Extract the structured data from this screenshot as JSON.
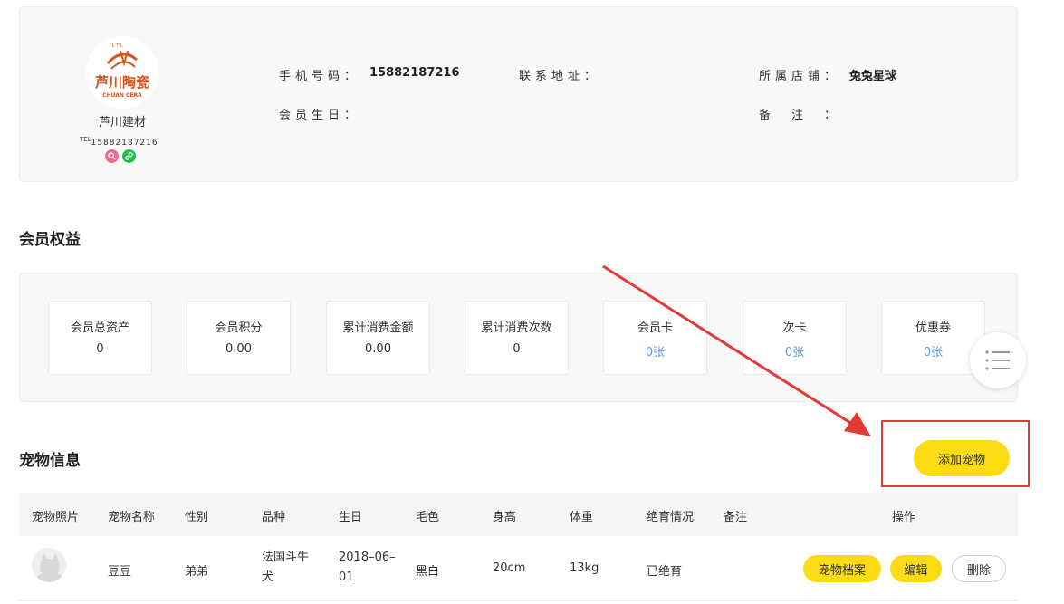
{
  "profile": {
    "store_name": "芦川建材",
    "logo_text_top": "芦川陶瓷",
    "logo_text_bottom": "CHUAN CERA",
    "logo_mark": "L T L",
    "tel_prefix": "TEL",
    "tel_number": "15882187216",
    "phone_label": "手机号码：",
    "phone_value": "15882187216",
    "address_label": "联系地址：",
    "address_value": "",
    "store_label": "所属店铺：",
    "store_value": "兔兔星球",
    "birthday_label": "会员生日：",
    "birthday_value": "",
    "remark_label": "备　注　：",
    "remark_value": ""
  },
  "benefits": {
    "title": "会员权益",
    "items": [
      {
        "label": "会员总资产",
        "value": "0"
      },
      {
        "label": "会员积分",
        "value": "0.00"
      },
      {
        "label": "累计消费金额",
        "value": "0.00"
      },
      {
        "label": "累计消费次数",
        "value": "0"
      },
      {
        "label": "会员卡",
        "value": "0张"
      },
      {
        "label": "次卡",
        "value": "0张"
      },
      {
        "label": "优惠券",
        "value": "0张"
      }
    ]
  },
  "pets": {
    "title": "宠物信息",
    "add_label": "添加宠物",
    "columns": [
      "宠物照片",
      "宠物名称",
      "性别",
      "品种",
      "生日",
      "毛色",
      "身高",
      "体重",
      "绝育情况",
      "备注",
      "操作"
    ],
    "rows": [
      {
        "name": "豆豆",
        "gender": "弟弟",
        "breed": "法国斗牛犬",
        "birthday": "2018–06–01",
        "color": "黑白",
        "height": "20cm",
        "weight": "13kg",
        "neutered": "已绝育",
        "remark": "",
        "actions": {
          "archive": "宠物档案",
          "edit": "编辑",
          "delete": "删除"
        }
      }
    ]
  },
  "colors": {
    "accent_yellow": "#fadb14",
    "link_blue": "#5a9bdc",
    "highlight_red": "#e53935"
  }
}
